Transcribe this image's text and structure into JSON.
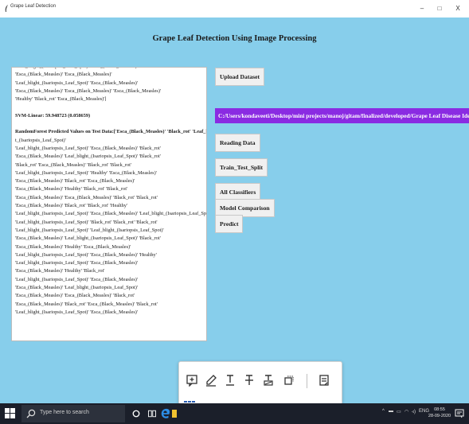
{
  "window": {
    "title": "Grape Leaf Detection",
    "minimize": "–",
    "maximize": "□",
    "close": "X"
  },
  "app": {
    "heading": "Grape Leaf Detection Using Image Processing"
  },
  "output_lines": [
    "'Leaf_blight_(Isariopsis_Leaf_Spot)' 'Esca_(Black_Measles)'",
    "'Esca_(Black_Measles)' 'Esca_(Black_Measles)'",
    "'Leaf_blight_(Isariopsis_Leaf_Spot)' 'Esca_(Black_Measles)'",
    "'Esca_(Black_Measles)' 'Esca_(Black_Measles)' 'Esca_(Black_Measles)'",
    "'Healthy' 'Black_rot' 'Esca_(Black_Measles)']",
    "",
    "SVM-Linear: 59.948723 (0.058659)",
    "",
    "RandomForest Predicted Values on Test Data:['Esca_(Black_Measles)' 'Black_rot' 'Leaf_bligh",
    "t_(Isariopsis_Leaf_Spot)'",
    "'Leaf_blight_(Isariopsis_Leaf_Spot)' 'Esca_(Black_Measles)' 'Black_rot'",
    "'Esca_(Black_Measles)' 'Leaf_blight_(Isariopsis_Leaf_Spot)' 'Black_rot'",
    "'Black_rot' 'Esca_(Black_Measles)' 'Black_rot' 'Black_rot'",
    "'Leaf_blight_(Isariopsis_Leaf_Spot)' 'Healthy' 'Esca_(Black_Measles)'",
    "'Esca_(Black_Measles)' 'Black_rot' 'Esca_(Black_Measles)'",
    "'Esca_(Black_Measles)' 'Healthy' 'Black_rot' 'Black_rot'",
    "'Esca_(Black_Measles)' 'Esca_(Black_Measles)' 'Black_rot' 'Black_rot'",
    "'Esca_(Black_Measles)' 'Black_rot' 'Black_rot' 'Healthy'",
    "'Leaf_blight_(Isariopsis_Leaf_Spot)' 'Esca_(Black_Measles)' 'Leaf_blight_(Isariopsis_Leaf_Spot)'",
    "'Leaf_blight_(Isariopsis_Leaf_Spot)' 'Black_rot' 'Black_rot' 'Black_rot'",
    "'Leaf_blight_(Isariopsis_Leaf_Spot)' 'Leaf_blight_(Isariopsis_Leaf_Spot)'",
    "'Esca_(Black_Measles)' 'Leaf_blight_(Isariopsis_Leaf_Spot)' 'Black_rot'",
    "'Esca_(Black_Measles)' 'Healthy' 'Esca_(Black_Measles)'",
    "'Leaf_blight_(Isariopsis_Leaf_Spot)' 'Esca_(Black_Measles)' 'Healthy'",
    "'Leaf_blight_(Isariopsis_Leaf_Spot)' 'Esca_(Black_Measles)'",
    "'Esca_(Black_Measles)' 'Healthy' 'Black_rot'",
    "'Leaf_blight_(Isariopsis_Leaf_Spot)' 'Esca_(Black_Measles)'",
    "'Esca_(Black_Measles)' 'Leaf_blight_(Isariopsis_Leaf_Spot)'",
    "'Esca_(Black_Measles)' 'Esca_(Black_Measles)' 'Black_rot'",
    "'Esca_(Black_Measles)' 'Black_rot' 'Esca_(Black_Measles)' 'Black_rot'",
    "'Leaf_blight_(Isariopsis_Leaf_Spot)' 'Esca_(Black_Measles)'"
  ],
  "buttons": {
    "upload": "Upload Dataset",
    "reading": "Reading Data",
    "split": "Train_Test_Split",
    "classifiers": "All Classifiers",
    "comparison": "Model Comparison",
    "predict": "Predict"
  },
  "dataset_path": "C:/Users/kondaveeti/Desktop/mini projects/manoj/gitam/finalized/developed/Grape Leaf Disease Identi",
  "floating_toolbar": {
    "tools": [
      "add-comment-icon",
      "highlighter-icon",
      "underline-icon",
      "strikethrough-icon",
      "replace-text-icon",
      "crop-icon",
      "notes-icon"
    ]
  },
  "taskbar": {
    "search_placeholder": "Type here to search",
    "language": "ENG",
    "time": "08:55",
    "date": "28-09-2020"
  },
  "colors": {
    "app_background": "#87ceeb",
    "path_highlight": "#8a2be2",
    "taskbar": "#1b1f2a"
  }
}
